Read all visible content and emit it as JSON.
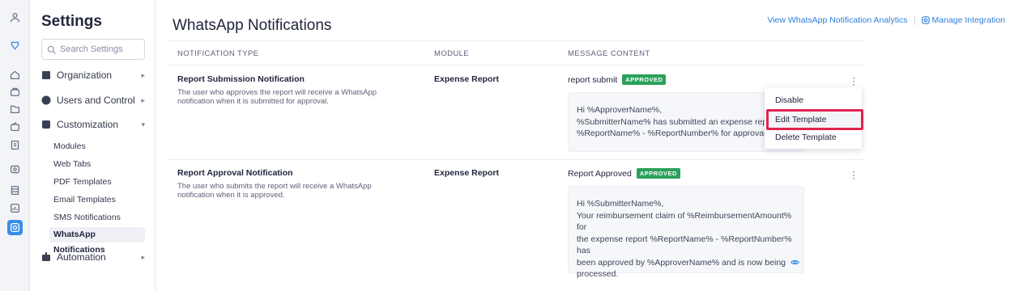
{
  "sidebar": {
    "title": "Settings",
    "search_placeholder": "Search Settings",
    "groups": {
      "organization": "Organization",
      "users": "Users and Control",
      "customization": "Customization",
      "automation": "Automation"
    },
    "items": [
      "Modules",
      "Web Tabs",
      "PDF Templates",
      "Email Templates",
      "SMS Notifications",
      "WhatsApp Notifications"
    ]
  },
  "header": {
    "title": "WhatsApp Notifications",
    "analytics_link": "View WhatsApp Notification Analytics",
    "integration_link": "Manage Integration"
  },
  "table": {
    "columns": [
      "NOTIFICATION TYPE",
      "MODULE",
      "MESSAGE CONTENT"
    ],
    "rows": [
      {
        "type": "Report Submission Notification",
        "description": "The user who approves the report will receive a WhatsApp notification when it is submitted for approval.",
        "module": "Expense Report",
        "template_name": "report submit",
        "status": "APPROVED",
        "message": [
          "Hi %ApproverName%,",
          "%SubmitterName% has submitted an expense rep",
          "%ReportName% - %ReportNumber% for approval."
        ]
      },
      {
        "type": "Report Approval Notification",
        "description": "The user who submits the report will receive a WhatsApp notification when it is approved.",
        "module": "Expense Report",
        "template_name": "Report Approved",
        "status": "APPROVED",
        "message": [
          "Hi %SubmitterName%,",
          "Your reimbursement claim of %ReimbursementAmount% for",
          "the expense report %ReportName% - %ReportNumber% has",
          "been approved by %ApproverName% and is now being",
          "processed."
        ]
      }
    ]
  },
  "context_menu": {
    "items": [
      "Disable",
      "Edit Template",
      "Delete Template"
    ]
  },
  "colors": {
    "accent": "#3a8ee6",
    "approved": "#2aa15b",
    "highlight": "#e0234e"
  }
}
